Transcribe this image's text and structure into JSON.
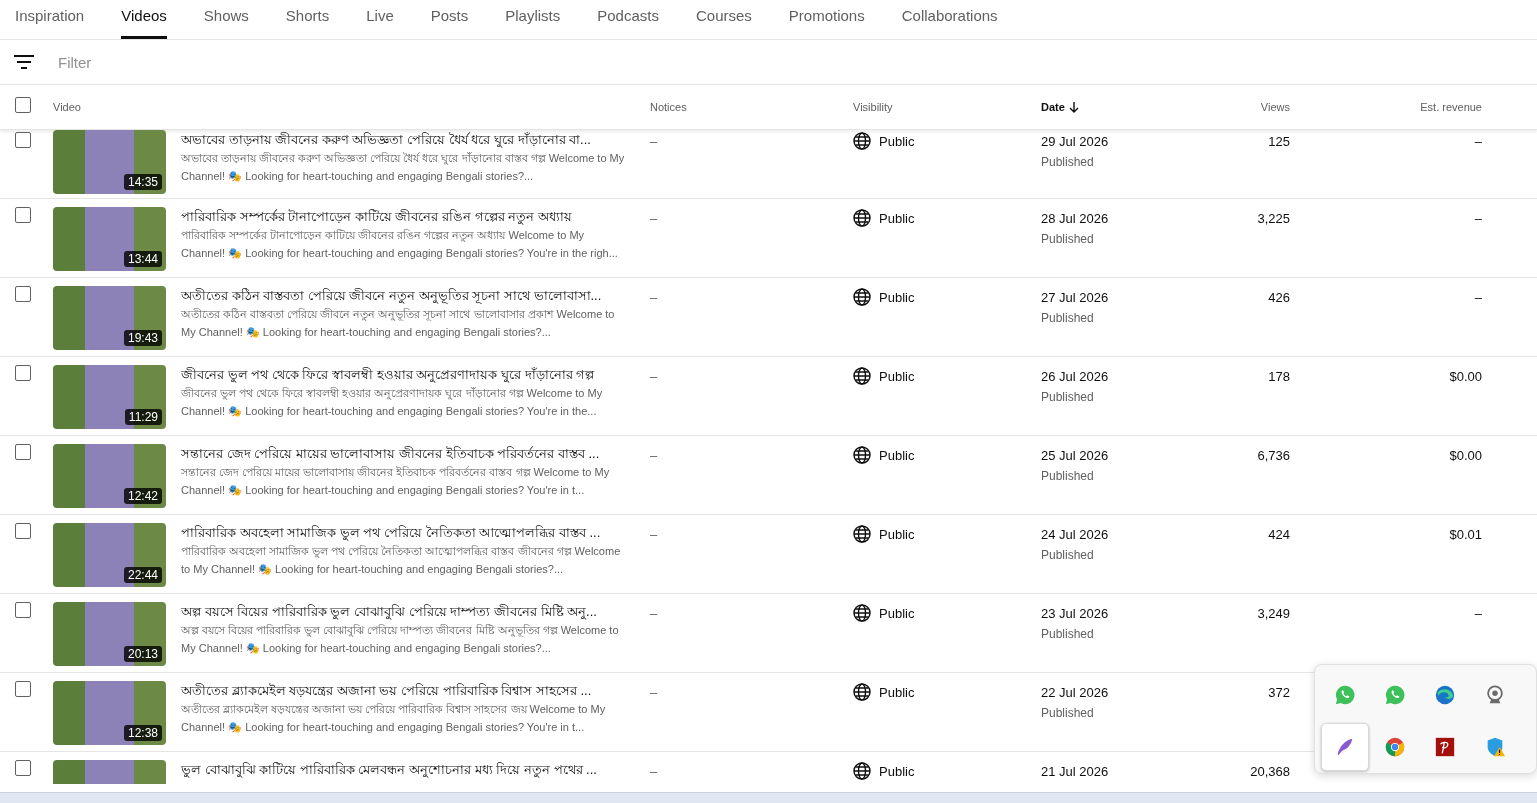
{
  "tabs": [
    {
      "label": "Inspiration",
      "selected": false
    },
    {
      "label": "Videos",
      "selected": true
    },
    {
      "label": "Shows",
      "selected": false
    },
    {
      "label": "Shorts",
      "selected": false
    },
    {
      "label": "Live",
      "selected": false
    },
    {
      "label": "Posts",
      "selected": false
    },
    {
      "label": "Playlists",
      "selected": false
    },
    {
      "label": "Podcasts",
      "selected": false
    },
    {
      "label": "Courses",
      "selected": false
    },
    {
      "label": "Promotions",
      "selected": false
    },
    {
      "label": "Collaborations",
      "selected": false
    }
  ],
  "filter": {
    "placeholder": "Filter"
  },
  "header": {
    "checked": false,
    "columns": [
      {
        "label": "Video",
        "sorted": false
      },
      {
        "label": "Notices",
        "sorted": false
      },
      {
        "label": "Visibility",
        "sorted": false
      },
      {
        "label": "Date",
        "sorted": true
      },
      {
        "label": "Views",
        "sorted": false
      },
      {
        "label": "Est. revenue",
        "sorted": false
      }
    ]
  },
  "rows": [
    {
      "checked": false,
      "duration": "14:35",
      "title": "অভাবের তাড়নায় জীবনের করুণ অভিজ্ঞতা পেরিয়ে ধৈর্য ধরে ঘুরে দাঁড়ানোর বা...",
      "description": "অভাবের তাড়নায় জীবনের করুণ অভিজ্ঞতা পেরিয়ে ধৈর্য ধরে ঘুরে দাঁড়ানোর বাস্তব গল্প Welcome to My Channel! 🎭 Looking for heart-touching and engaging Bengali stories?...",
      "notices": "–",
      "visibility": "Public",
      "date": "29 Jul 2026",
      "status": "Published",
      "views": "125",
      "revenue": "–"
    },
    {
      "checked": false,
      "duration": "13:44",
      "title": "পারিবারিক সম্পর্কের টানাপোড়েন কাটিয়ে জীবনের রঙিন গল্পের নতুন অধ্যায়",
      "description": "পারিবারিক সম্পর্কের টানাপোড়েন কাটিয়ে জীবনের রঙিন গল্পের নতুন অধ্যায় Welcome to My Channel! 🎭 Looking for heart-touching and engaging Bengali stories? You're in the righ...",
      "notices": "–",
      "visibility": "Public",
      "date": "28 Jul 2026",
      "status": "Published",
      "views": "3,225",
      "revenue": "–"
    },
    {
      "checked": false,
      "duration": "19:43",
      "title": "অতীতের কঠিন বাস্তবতা পেরিয়ে জীবনে নতুন অনুভূতির সূচনা সাথে ভালোবাসা...",
      "description": "অতীতের কঠিন বাস্তবতা পেরিয়ে জীবনে নতুন অনুভূতির সূচনা সাথে ভালোবাসার প্রকাশ Welcome to My Channel! 🎭 Looking for heart-touching and engaging Bengali stories?...",
      "notices": "–",
      "visibility": "Public",
      "date": "27 Jul 2026",
      "status": "Published",
      "views": "426",
      "revenue": "–"
    },
    {
      "checked": false,
      "duration": "11:29",
      "title": "জীবনের ভুল পথ থেকে ফিরে স্বাবলম্বী হওয়ার অনুপ্রেরণাদায়ক ঘুরে দাঁড়ানোর গল্প",
      "description": "জীবনের ভুল পথ থেকে ফিরে স্বাবলম্বী হওয়ার অনুপ্রেরণাদায়ক ঘুরে দাঁড়ানোর গল্প Welcome to My Channel! 🎭 Looking for heart-touching and engaging Bengali stories? You're in the...",
      "notices": "–",
      "visibility": "Public",
      "date": "26 Jul 2026",
      "status": "Published",
      "views": "178",
      "revenue": "$0.00"
    },
    {
      "checked": false,
      "duration": "12:42",
      "title": "সন্তানের জেদ পেরিয়ে মায়ের ভালোবাসায় জীবনের ইতিবাচক পরিবর্তনের বাস্তব ...",
      "description": "সন্তানের জেদ পেরিয়ে মায়ের ভালোবাসায় জীবনের ইতিবাচক পরিবর্তনের বাস্তব গল্প Welcome to My Channel! 🎭 Looking for heart-touching and engaging Bengali stories? You're in t...",
      "notices": "–",
      "visibility": "Public",
      "date": "25 Jul 2026",
      "status": "Published",
      "views": "6,736",
      "revenue": "$0.00"
    },
    {
      "checked": false,
      "duration": "22:44",
      "title": "পারিবারিক অবহেলা সামাজিক ভুল পথ পেরিয়ে নৈতিকতা আত্মোপলব্ধির বাস্তব ...",
      "description": "পারিবারিক অবহেলা সামাজিক ভুল পথ পেরিয়ে নৈতিকতা আত্মোপলব্ধির বাস্তব জীবনের গল্প Welcome to My Channel! 🎭 Looking for heart-touching and engaging Bengali stories?...",
      "notices": "–",
      "visibility": "Public",
      "date": "24 Jul 2026",
      "status": "Published",
      "views": "424",
      "revenue": "$0.01"
    },
    {
      "checked": false,
      "duration": "20:13",
      "title": "অল্প বয়সে বিয়ের পারিবারিক ভুল বোঝাবুঝি পেরিয়ে দাম্পত্য জীবনের মিষ্টি অনু...",
      "description": "অল্প বয়সে বিয়ের পারিবারিক ভুল বোঝাবুঝি পেরিয়ে দাম্পত্য জীবনের মিষ্টি অনুভূতির গল্প Welcome to My Channel! 🎭 Looking for heart-touching and engaging Bengali stories?...",
      "notices": "–",
      "visibility": "Public",
      "date": "23 Jul 2026",
      "status": "Published",
      "views": "3,249",
      "revenue": "–"
    },
    {
      "checked": false,
      "duration": "12:38",
      "title": "অতীতের ব্ল্যাকমেইল ষড়যন্ত্রের অজানা ভয় পেরিয়ে পারিবারিক বিশ্বাস সাহসের ...",
      "description": "অতীতের ব্ল্যাকমেইল ষড়যন্ত্রের অজানা ভয় পেরিয়ে পারিবারিক বিশ্বাস সাহসের জয় Welcome to My Channel! 🎭 Looking for heart-touching and engaging Bengali stories? You're in t...",
      "notices": "–",
      "visibility": "Public",
      "date": "22 Jul 2026",
      "status": "Published",
      "views": "372",
      "revenue": ""
    },
    {
      "checked": false,
      "title": "ভুল বোঝাবুঝি কাটিয়ে পারিবারিক মেলবন্ধন অনুশোচনার মধ্য দিয়ে নতুন পথের ...",
      "notices": "–",
      "visibility": "Public",
      "date": "21 Jul 2026",
      "views": "20,368"
    }
  ],
  "tray": [
    {
      "kind": "whatsapp",
      "selected": false
    },
    {
      "kind": "whatsapp",
      "selected": false
    },
    {
      "kind": "edge",
      "selected": false
    },
    {
      "kind": "webcam",
      "selected": false
    },
    {
      "kind": "feather",
      "selected": true
    },
    {
      "kind": "chrome",
      "selected": false
    },
    {
      "kind": "pdf",
      "selected": false
    },
    {
      "kind": "shield",
      "selected": false
    }
  ]
}
